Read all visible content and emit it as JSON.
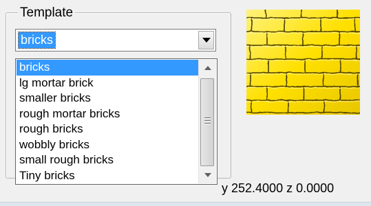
{
  "template_group": {
    "title": "Template"
  },
  "combo": {
    "selected": "bricks"
  },
  "dropdown": {
    "items": [
      "bricks",
      "lg mortar brick",
      "smaller bricks",
      "rough mortar bricks",
      "rough bricks",
      "wobbly bricks",
      "small rough bricks",
      "Tiny bricks"
    ],
    "selected_index": 0
  },
  "coords": {
    "text": "y 252.4000 z 0.0000"
  },
  "preview": {
    "texture": "yellow brick pattern"
  },
  "colors": {
    "selection": "#3399ff",
    "texture_base": "#ffe61a",
    "mortar": "#3a2f00"
  }
}
